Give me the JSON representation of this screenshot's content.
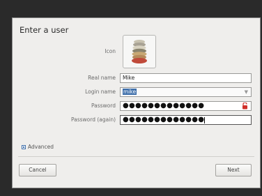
{
  "dialog": {
    "title": "Enter a user",
    "labels": {
      "icon": "Icon",
      "real_name": "Real name",
      "login_name": "Login name",
      "password": "Password",
      "password_again": "Password (again)"
    },
    "fields": {
      "real_name": "Mike",
      "login_name": "mike",
      "password": "●●●●●●●●●●●●●",
      "password_again": "●●●●●●●●●●●●●"
    },
    "advanced_label": "Advanced",
    "buttons": {
      "cancel": "Cancel",
      "next": "Next"
    }
  },
  "icons": {
    "avatar": "stacked-stones-avatar-icon",
    "dropdown": "chevron-down-icon",
    "password_warning": "lock-warning-icon",
    "expander": "expander-icon"
  },
  "colors": {
    "background": "#2a2a2a",
    "dialog": "#efeeec",
    "selection": "#3d6eaa",
    "warning": "#d0302a"
  }
}
